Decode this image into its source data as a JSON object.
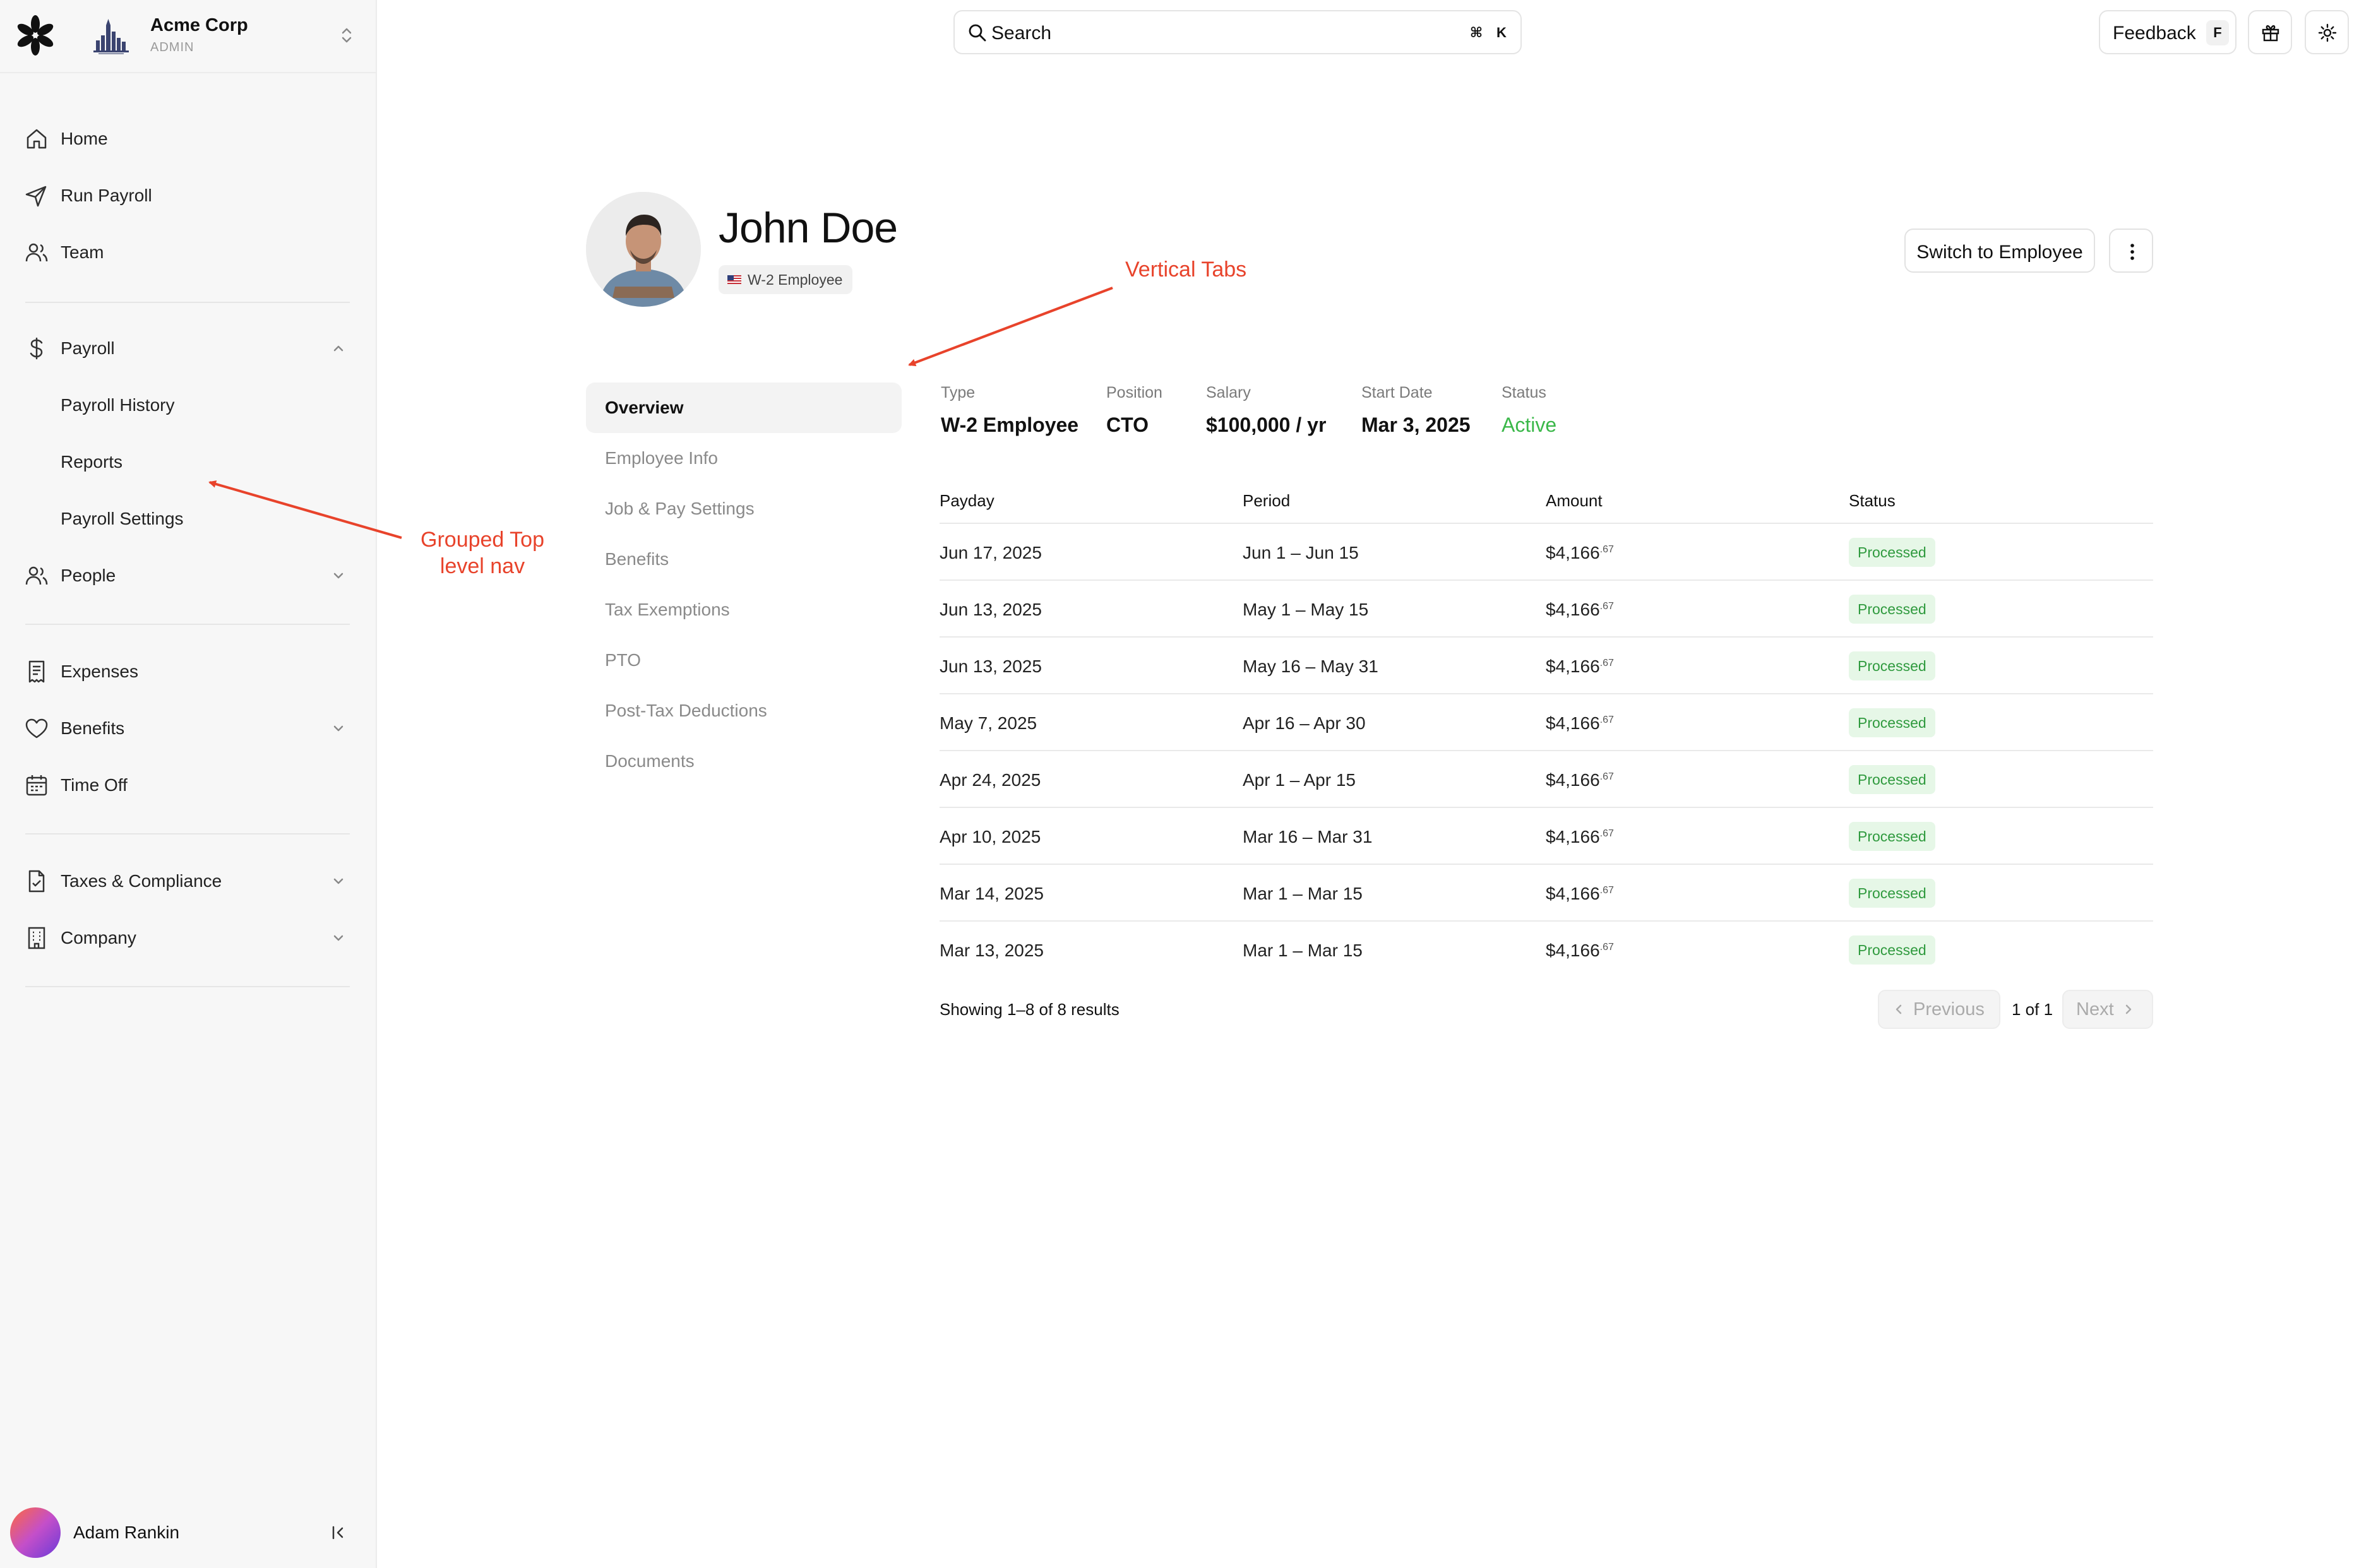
{
  "org": {
    "name": "Acme Corp",
    "role": "ADMIN"
  },
  "nav": {
    "home": "Home",
    "run_payroll": "Run Payroll",
    "team": "Team",
    "payroll": "Payroll",
    "payroll_history": "Payroll History",
    "reports": "Reports",
    "payroll_settings": "Payroll Settings",
    "people": "People",
    "expenses": "Expenses",
    "benefits": "Benefits",
    "time_off": "Time Off",
    "taxes": "Taxes & Compliance",
    "company": "Company"
  },
  "user": {
    "name": "Adam Rankin"
  },
  "search": {
    "placeholder": "Search",
    "shortcut_cmd": "⌘",
    "shortcut_key": "K"
  },
  "topbar": {
    "feedback": "Feedback",
    "feedback_key": "F"
  },
  "profile": {
    "name": "John Doe",
    "badge": "W-2 Employee",
    "switch_button": "Switch to Employee"
  },
  "annotations": {
    "vertical_tabs": "Vertical Tabs",
    "grouped_nav_line1": "Grouped Top",
    "grouped_nav_line2": "level nav",
    "color": "#e8432b"
  },
  "tabs": [
    {
      "label": "Overview",
      "active": true
    },
    {
      "label": "Employee Info"
    },
    {
      "label": "Job & Pay Settings"
    },
    {
      "label": "Benefits"
    },
    {
      "label": "Tax Exemptions"
    },
    {
      "label": "PTO"
    },
    {
      "label": "Post-Tax Deductions"
    },
    {
      "label": "Documents"
    }
  ],
  "summary": [
    {
      "label": "Type",
      "value": "W-2 Employee"
    },
    {
      "label": "Position",
      "value": "CTO"
    },
    {
      "label": "Salary",
      "value": "$100,000 / yr"
    },
    {
      "label": "Start Date",
      "value": "Mar 3, 2025"
    },
    {
      "label": "Status",
      "value": "Active"
    }
  ],
  "table": {
    "headers": [
      "Payday",
      "Period",
      "Amount",
      "Status"
    ],
    "rows": [
      {
        "payday": "Jun 17, 2025",
        "period": "Jun 1 – Jun 15",
        "amount": "$4,166",
        "cents": ".67",
        "status": "Processed"
      },
      {
        "payday": "Jun 13, 2025",
        "period": "May 1 – May 15",
        "amount": "$4,166",
        "cents": ".67",
        "status": "Processed"
      },
      {
        "payday": "Jun 13, 2025",
        "period": "May 16 – May 31",
        "amount": "$4,166",
        "cents": ".67",
        "status": "Processed"
      },
      {
        "payday": "May 7, 2025",
        "period": "Apr 16 – Apr 30",
        "amount": "$4,166",
        "cents": ".67",
        "status": "Processed"
      },
      {
        "payday": "Apr 24, 2025",
        "period": "Apr 1 – Apr 15",
        "amount": "$4,166",
        "cents": ".67",
        "status": "Processed"
      },
      {
        "payday": "Apr 10, 2025",
        "period": "Mar 16 – Mar 31",
        "amount": "$4,166",
        "cents": ".67",
        "status": "Processed"
      },
      {
        "payday": "Mar 14, 2025",
        "period": "Mar 1 – Mar 15",
        "amount": "$4,166",
        "cents": ".67",
        "status": "Processed"
      },
      {
        "payday": "Mar 13, 2025",
        "period": "Mar 1 – Mar 15",
        "amount": "$4,166",
        "cents": ".67",
        "status": "Processed"
      }
    ]
  },
  "pagination": {
    "showing": "Showing 1–8 of 8 results",
    "previous": "Previous",
    "page": "1 of 1",
    "next": "Next"
  },
  "colors": {
    "active_status": "#3bb84a",
    "processed_bg": "#e6f7e7",
    "processed_text": "#2f9a3e"
  }
}
